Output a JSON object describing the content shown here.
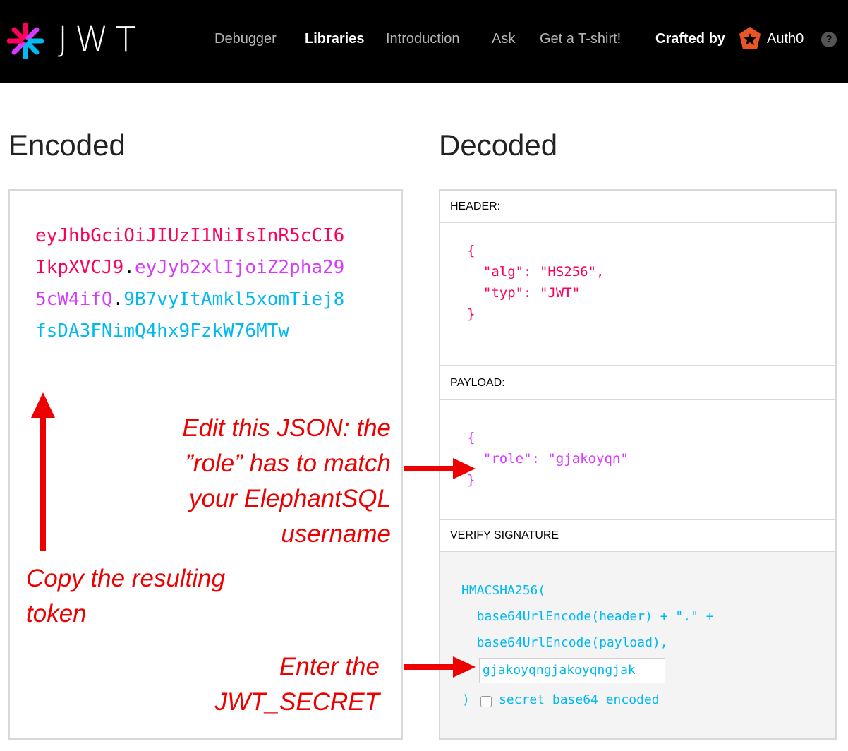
{
  "header": {
    "logo_text": "JWT",
    "nav": [
      "Debugger",
      "Libraries",
      "Introduction",
      "Ask",
      "Get a T-shirt!"
    ],
    "active_nav": "Libraries",
    "crafted_by": "Crafted by",
    "brand": "Auth0",
    "help_icon": "?"
  },
  "encoded": {
    "title": "Encoded",
    "token_header": "eyJhbGciOiJIUzI1NiIsInR5cCI6IkpXVCJ9",
    "token_payload": "eyJyb2xlIjoiZ2pha295cW4ifQ",
    "token_signature": "9B7vyItAmkl5xomTiej8fsDA3FNimQ4hx9FzkW76MTw",
    "dot": "."
  },
  "decoded": {
    "title": "Decoded",
    "header_label": "HEADER:",
    "header_json": "{\n  \"alg\": \"HS256\",\n  \"typ\": \"JWT\"\n}",
    "payload_label": "PAYLOAD:",
    "payload_json": "{\n  \"role\": \"gjakoyqn\"\n}",
    "verify_label": "VERIFY SIGNATURE",
    "verify_code": "HMACSHA256(\n  base64UrlEncode(header) + \".\" +\n  base64UrlEncode(payload),",
    "secret_value": "gjakoyqngjakoyqngjak",
    "close_paren": ")",
    "checkbox_label": "secret base64 encoded"
  },
  "annotations": {
    "edit_json": "Edit this JSON: the\n”role” has to match\nyour ElephantSQL\nusername",
    "copy_token": "Copy the resulting\ntoken",
    "enter_secret": "Enter the\nJWT_SECRET"
  },
  "colors": {
    "token_header": "#fb015b",
    "token_payload": "#d63aff",
    "token_signature": "#00b9f1",
    "annotation": "#ee0000",
    "topbar": "#000000"
  }
}
